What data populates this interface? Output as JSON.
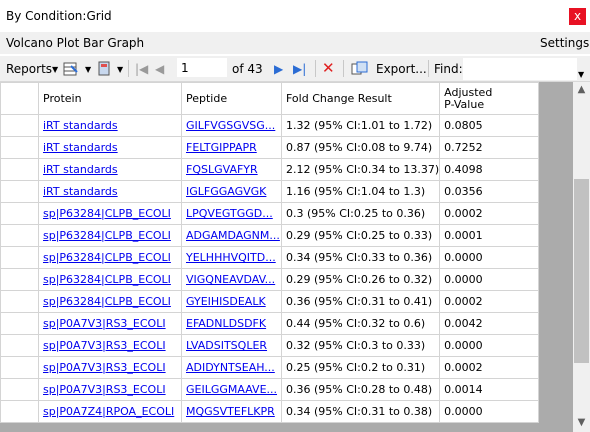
{
  "window": {
    "title": "By Condition:Grid",
    "close_label": "x"
  },
  "menu": {
    "items": [
      "Volcano Plot",
      "Bar Graph"
    ],
    "settings": "Settings"
  },
  "toolbar": {
    "reports_label": "Reports",
    "page_value": "1",
    "page_of": "of 43",
    "export_label": "Export...",
    "find_label": "Find:",
    "find_value": ""
  },
  "grid": {
    "columns": [
      "Protein",
      "Peptide",
      "Fold Change Result",
      "Adjusted\nP-Value"
    ],
    "rows": [
      [
        "iRT standards",
        "GILFVGSGVSG...",
        "1.32 (95% CI:1.01 to 1.72)",
        "0.0805"
      ],
      [
        "iRT standards",
        "FELTGIPPAPR",
        "0.87 (95% CI:0.08 to 9.74)",
        "0.7252"
      ],
      [
        "iRT standards",
        "FQSLGVAFYR",
        "2.12 (95% CI:0.34 to 13.37)",
        "0.4098"
      ],
      [
        "iRT standards",
        "IGLFGGAGVGK",
        "1.16 (95% CI:1.04 to 1.3)",
        "0.0356"
      ],
      [
        "sp|P63284|CLPB_ECOLI",
        "LPQVEGTGGD...",
        "0.3 (95% CI:0.25 to 0.36)",
        "0.0002"
      ],
      [
        "sp|P63284|CLPB_ECOLI",
        "ADGAMDAGNM...",
        "0.29 (95% CI:0.25 to 0.33)",
        "0.0001"
      ],
      [
        "sp|P63284|CLPB_ECOLI",
        "YELHHHVQITD...",
        "0.34 (95% CI:0.33 to 0.36)",
        "0.0000"
      ],
      [
        "sp|P63284|CLPB_ECOLI",
        "VIGQNEAVDAV...",
        "0.29 (95% CI:0.26 to 0.32)",
        "0.0000"
      ],
      [
        "sp|P63284|CLPB_ECOLI",
        "GYEIHISDEALK",
        "0.36 (95% CI:0.31 to 0.41)",
        "0.0002"
      ],
      [
        "sp|P0A7V3|RS3_ECOLI",
        "EFADNLDSDFK",
        "0.44 (95% CI:0.32 to 0.6)",
        "0.0042"
      ],
      [
        "sp|P0A7V3|RS3_ECOLI",
        "LVADSITSQLER",
        "0.32 (95% CI:0.3 to 0.33)",
        "0.0000"
      ],
      [
        "sp|P0A7V3|RS3_ECOLI",
        "ADIDYNTSEAH...",
        "0.25 (95% CI:0.2 to 0.31)",
        "0.0002"
      ],
      [
        "sp|P0A7V3|RS3_ECOLI",
        "GEILGGMAAVE...",
        "0.36 (95% CI:0.28 to 0.48)",
        "0.0014"
      ],
      [
        "sp|P0A7Z4|RPOA_ECOLI",
        "MQGSVTEFLKPR",
        "0.34 (95% CI:0.31 to 0.38)",
        "0.0000"
      ]
    ]
  }
}
